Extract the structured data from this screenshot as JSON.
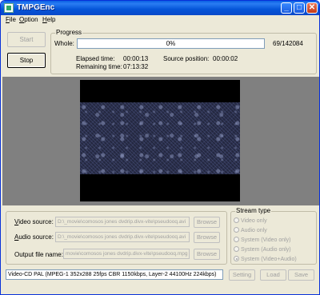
{
  "window": {
    "title": "TMPGEnc"
  },
  "titlebar_buttons": {
    "minimize": "_",
    "maximize": "□",
    "close": "✕"
  },
  "menu": [
    {
      "label": "File",
      "access": "F",
      "rest": "ile"
    },
    {
      "label": "Option",
      "access": "O",
      "rest": "ption"
    },
    {
      "label": "Help",
      "access": "H",
      "rest": "elp"
    }
  ],
  "controls": {
    "start_label": "Start",
    "stop_label": "Stop"
  },
  "progress": {
    "group_label": "Progress",
    "whole_label": "Whole:",
    "percent_text": "0%",
    "frames": "69/142084",
    "elapsed_label": "Elapsed time:",
    "elapsed_value": "00:00:13",
    "source_pos_label": "Source position:",
    "source_pos_value": "00:00:02",
    "remaining_label": "Remaining time:",
    "remaining_value": "07:13:32"
  },
  "files": {
    "video_label_u": "V",
    "video_label_rest": "ideo source:",
    "video_value": "D:\\_movie\\comosos jones dvdrip.divx-vite\\pseudooq.avi",
    "audio_label_u": "A",
    "audio_label_rest": "udio source:",
    "audio_value": "D:\\_movie\\comosos jones dvdrip.divx-vite\\pseudooq.avi",
    "output_label": "Output file name:",
    "output_value": "movie\\comosos jones dvdrip.divx-vite\\pseudooq.mpg",
    "browse_label": "Browse"
  },
  "stream_type": {
    "group_label": "Stream type",
    "options": [
      {
        "label": "Video only",
        "selected": false
      },
      {
        "label": "Audio only",
        "selected": false
      },
      {
        "label": "System (Video only)",
        "selected": false
      },
      {
        "label": "System (Audio only)",
        "selected": false
      },
      {
        "label": "System (Video+Audio)",
        "selected": true
      }
    ]
  },
  "status": {
    "text": "Video-CD PAL (MPEG-1 352x288 25fps CBR 1150kbps,  Layer-2 44100Hz 224kbps)"
  },
  "bottom_buttons": {
    "setting": "Setting",
    "load": "Load",
    "save": "Save"
  },
  "colors": {
    "titlebar": "#0a5fe3",
    "face": "#ece9d8",
    "preview_bg": "#808080"
  }
}
